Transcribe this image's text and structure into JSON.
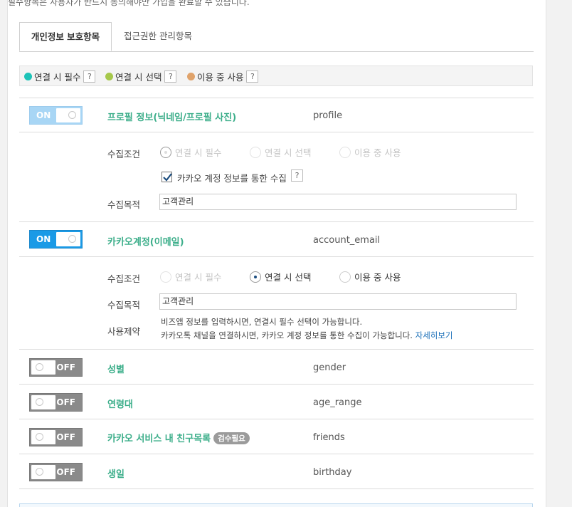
{
  "notice": "필수항목은 사용자가 반드시 동의해야만 가입을 완료할 수 있습니다.",
  "tabs": {
    "personal": "개인정보 보호항목",
    "access": "접근권한 관리항목"
  },
  "legend": {
    "required": "연결 시 필수",
    "optional": "연결 시 선택",
    "on_use": "이용 중 사용",
    "help": "?",
    "colors": {
      "required": "#1dc3b8",
      "optional": "#a6c84b",
      "on_use": "#e0a36b"
    }
  },
  "labels": {
    "condition": "수집조건",
    "purpose": "수집목적",
    "restriction": "사용제약",
    "on": "ON",
    "off": "OFF",
    "radio_required": "연결 시 필수",
    "radio_optional": "연결 시 선택",
    "radio_on_use": "이용 중 사용"
  },
  "items": {
    "profile": {
      "title": "프로필 정보(닉네임/프로필 사진)",
      "key": "profile",
      "state": "ON",
      "checkbox_label": "카카오 계정 정보를 통한 수집",
      "purpose": "고객관리"
    },
    "email": {
      "title": "카카오계정(이메일)",
      "key": "account_email",
      "state": "ON",
      "purpose": "고객관리",
      "restriction_line1": "비즈앱 정보를 입력하시면, 연결시 필수 선택이 가능합니다.",
      "restriction_line2": "카카오톡 채널을 연결하시면, 카카오 계정 정보를 통한 수집이 가능합니다.",
      "detail_link": "자세히보기"
    },
    "gender": {
      "title": "성별",
      "key": "gender",
      "state": "OFF"
    },
    "age_range": {
      "title": "연령대",
      "key": "age_range",
      "state": "OFF"
    },
    "friends": {
      "title": "카카오 서비스 내 친구목록",
      "badge": "검수필요",
      "key": "friends",
      "state": "OFF"
    },
    "birthday": {
      "title": "생일",
      "key": "birthday",
      "state": "OFF"
    }
  }
}
